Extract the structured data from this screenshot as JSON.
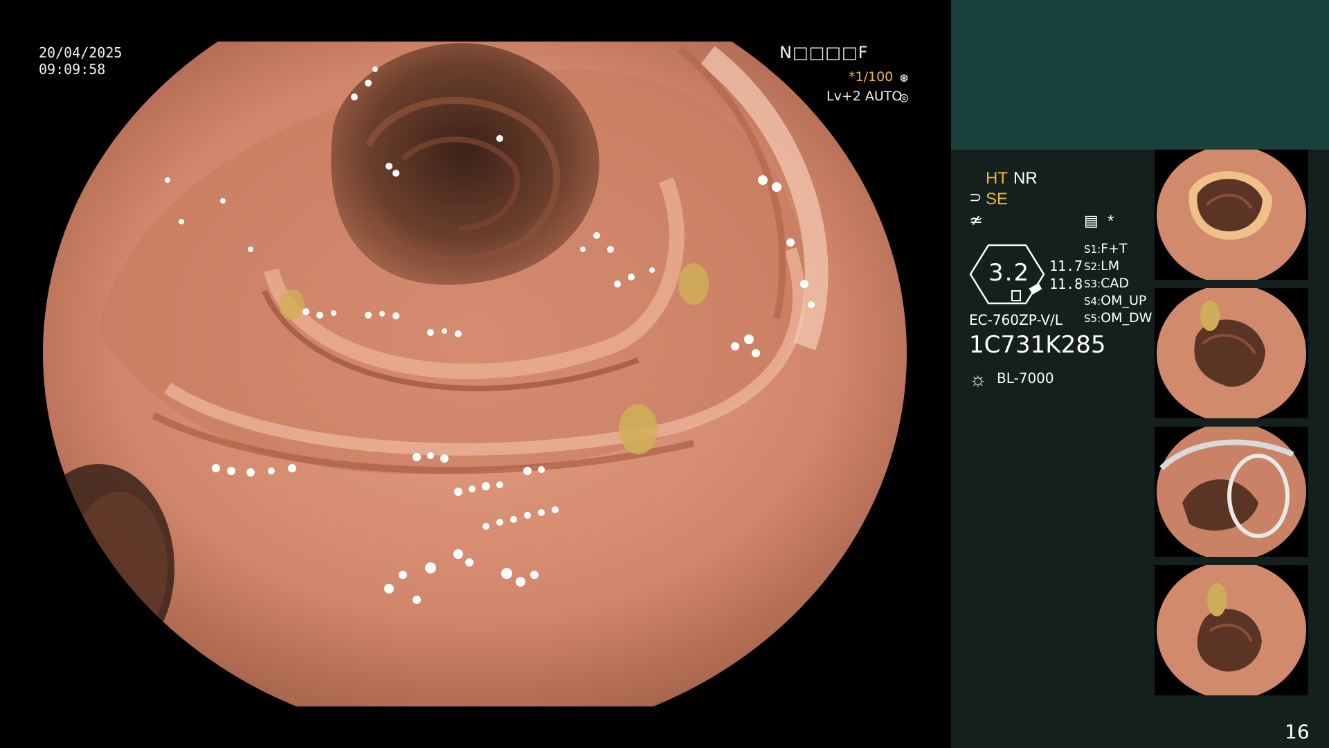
{
  "overlay": {
    "date": "20/04/2025",
    "time": "09:09:58",
    "patient_id": "N□□□□F",
    "shutter": "*1/100",
    "shutter_icon": "⊛",
    "level": "Lv+2 AUTO",
    "auto_icon": "◎"
  },
  "panel": {
    "ht": "HT",
    "nr": "NR",
    "se": "SE",
    "se_icon": "⊃",
    "f_icon": "≄",
    "memory_icon": "▤",
    "star": "*",
    "gauge_value": "3.2",
    "value_1": "11.7",
    "value_2": "11.8",
    "scope_model": "EC-760ZP-V/L",
    "serial": "1C731K285",
    "light_icon": "☼",
    "light_source": "BL-7000",
    "switches": [
      {
        "key": "S1:",
        "value": "F+T"
      },
      {
        "key": "S2:",
        "value": "LM"
      },
      {
        "key": "S3:",
        "value": "CAD"
      },
      {
        "key": "S4:",
        "value": "OM_UP"
      },
      {
        "key": "S5:",
        "value": "OM_DW"
      }
    ],
    "page_number": "16"
  },
  "colors": {
    "accent_orange": "#f3b531",
    "panel_bg": "#13201e",
    "panel_top_bg": "#19403b",
    "mucosa": "#d98c6c",
    "lumen_dark": "#5a3526"
  }
}
